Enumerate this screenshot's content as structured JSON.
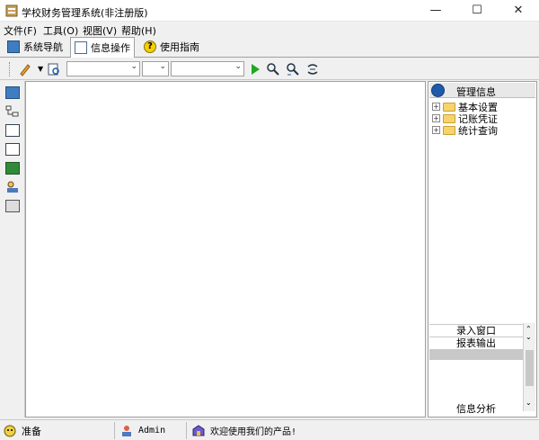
{
  "window": {
    "title": "学校财务管理系统(非注册版)",
    "min": "—",
    "max": "☐",
    "close": "✕"
  },
  "menu": [
    "文件(F)",
    "工具(O)",
    "视图(V)",
    "帮助(H)"
  ],
  "tabs": [
    "系统导航",
    "信息操作",
    "使用指南"
  ],
  "right_panel": {
    "header": "管理信息",
    "tree": [
      "基本设置",
      "记账凭证",
      "统计查询"
    ],
    "bottom": [
      "录入窗口",
      "报表输出",
      "信息分析"
    ]
  },
  "status": {
    "ready": "准备",
    "user": "Admin",
    "welcome": "欢迎使用我们的产品!"
  },
  "colors": {
    "accent": "#1f5aa8",
    "folder": "#f7d46b"
  }
}
